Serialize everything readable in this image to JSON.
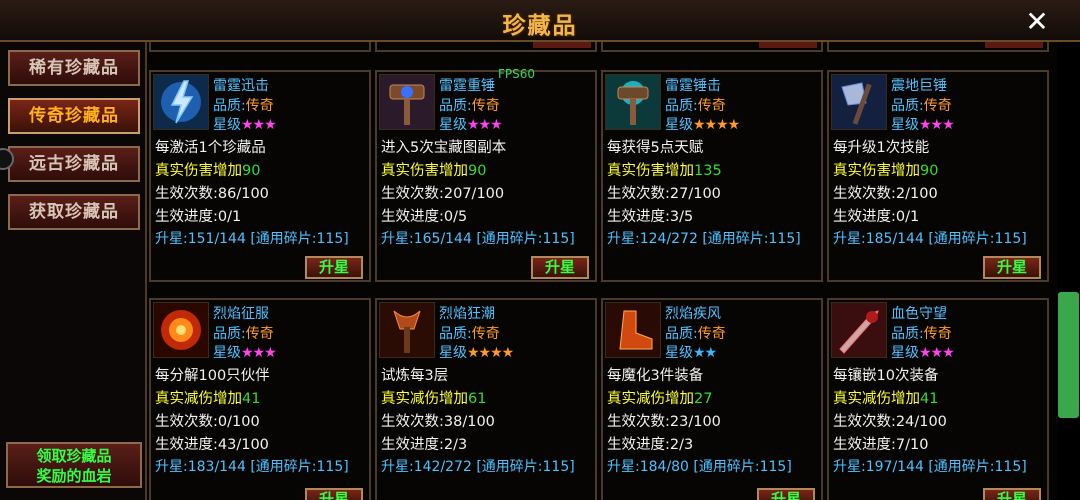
{
  "window": {
    "title": "珍藏品",
    "close_label": "✕"
  },
  "sidebar": {
    "tabs": [
      {
        "label": "稀有珍藏品",
        "active": false
      },
      {
        "label": "传奇珍藏品",
        "active": true
      },
      {
        "label": "远古珍藏品",
        "active": false
      },
      {
        "label": "获取珍藏品",
        "active": false
      }
    ],
    "claim_line1": "领取珍藏品",
    "claim_line2": "奖励的血岩"
  },
  "fps": "FPS60",
  "labels": {
    "quality": "品质:",
    "star": "星级"
  },
  "colors": {
    "star_pink": "#ff44ee",
    "star_orange": "#ff9a2a",
    "star_blue": "#3ab8ff"
  },
  "cards": [
    {
      "name": "雷霆迅击",
      "quality": "传奇",
      "stars": "★★★",
      "star_color": "#ff44ee",
      "icon": "lightning-icon",
      "condition": "每激活1个珍藏品",
      "effect_label": "真实伤害增加",
      "effect_value": "90",
      "count": "生效次数:86/100",
      "progress": "生效进度:0/1",
      "upgrade": "升星:151/144 [通用碎片:115]",
      "button": "升星"
    },
    {
      "name": "雷霆重锤",
      "quality": "传奇",
      "stars": "★★★",
      "star_color": "#ff44ee",
      "icon": "hammer-icon",
      "condition": "进入5次宝藏图副本",
      "effect_label": "真实伤害增加",
      "effect_value": "90",
      "count": "生效次数:207/100",
      "progress": "生效进度:0/5",
      "upgrade": "升星:165/144 [通用碎片:115]",
      "button": "升星"
    },
    {
      "name": "雷霆锤击",
      "quality": "传奇",
      "stars": "★★★★",
      "star_color": "#ff9a2a",
      "icon": "thunder-hammer-icon",
      "condition": "每获得5点天赋",
      "effect_label": "真实伤害增加",
      "effect_value": "135",
      "count": "生效次数:27/100",
      "progress": "生效进度:3/5",
      "upgrade": "升星:124/272 [通用碎片:115]",
      "button": ""
    },
    {
      "name": "震地巨锤",
      "quality": "传奇",
      "stars": "★★★",
      "star_color": "#ff44ee",
      "icon": "axe-icon",
      "condition": "每升级1次技能",
      "effect_label": "真实伤害增加",
      "effect_value": "90",
      "count": "生效次数:2/100",
      "progress": "生效进度:0/1",
      "upgrade": "升星:185/144 [通用碎片:115]",
      "button": "升星"
    },
    {
      "name": "烈焰征服",
      "quality": "传奇",
      "stars": "★★★",
      "star_color": "#ff44ee",
      "icon": "fire-orb-icon",
      "condition": "每分解100只伙伴",
      "effect_label": "真实减伤增加",
      "effect_value": "41",
      "count": "生效次数:0/100",
      "progress": "生效进度:43/100",
      "upgrade": "升星:183/144 [通用碎片:115]",
      "button": "升星"
    },
    {
      "name": "烈焰狂潮",
      "quality": "传奇",
      "stars": "★★★★",
      "star_color": "#ff9a2a",
      "icon": "flame-staff-icon",
      "condition": "试炼每3层",
      "effect_label": "真实减伤增加",
      "effect_value": "61",
      "count": "生效次数:38/100",
      "progress": "生效进度:2/3",
      "upgrade": "升星:142/272 [通用碎片:115]",
      "button": ""
    },
    {
      "name": "烈焰疾风",
      "quality": "传奇",
      "stars": "★★",
      "star_color": "#3ab8ff",
      "icon": "fire-boot-icon",
      "condition": "每魔化3件装备",
      "effect_label": "真实减伤增加",
      "effect_value": "27",
      "count": "生效次数:23/100",
      "progress": "生效进度:2/3",
      "upgrade": "升星:184/80 [通用碎片:115]",
      "button": "升星"
    },
    {
      "name": "血色守望",
      "quality": "传奇",
      "stars": "★★★",
      "star_color": "#ff44ee",
      "icon": "blood-spear-icon",
      "condition": "每镶嵌10次装备",
      "effect_label": "真实减伤增加",
      "effect_value": "41",
      "count": "生效次数:24/100",
      "progress": "生效进度:7/10",
      "upgrade": "升星:197/144 [通用碎片:115]",
      "button": "升星"
    }
  ]
}
